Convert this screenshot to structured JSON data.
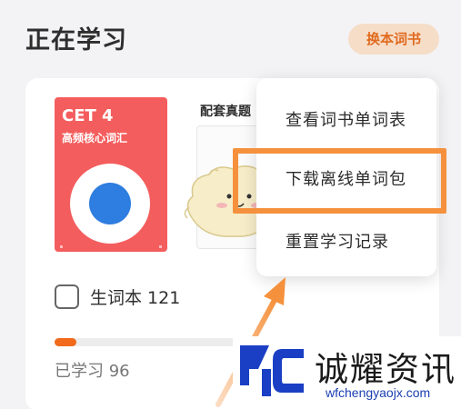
{
  "header": {
    "title": "正在学习",
    "switch_button": "换本词书"
  },
  "book": {
    "level": "CET 4",
    "subtitle": "高频核心词汇",
    "cover_color": "#f45d5d",
    "ring_color": "#ffffff",
    "dot_color": "#2e7de0"
  },
  "exam": {
    "label": "配套真题"
  },
  "vocab": {
    "label": "生词本 121",
    "checked": false
  },
  "progress": {
    "learned_label": "已学习 96",
    "fraction": 0.12,
    "color": "#f26a1b"
  },
  "menu": {
    "items": [
      {
        "label": "查看词书单词表"
      },
      {
        "label": "下载离线单词包"
      },
      {
        "label": "重置学习记录"
      }
    ],
    "highlighted_index": 1,
    "highlight_color": "#f5913d"
  },
  "watermark": {
    "name": "诚耀资讯",
    "url": "wfchengyaojx.com"
  }
}
